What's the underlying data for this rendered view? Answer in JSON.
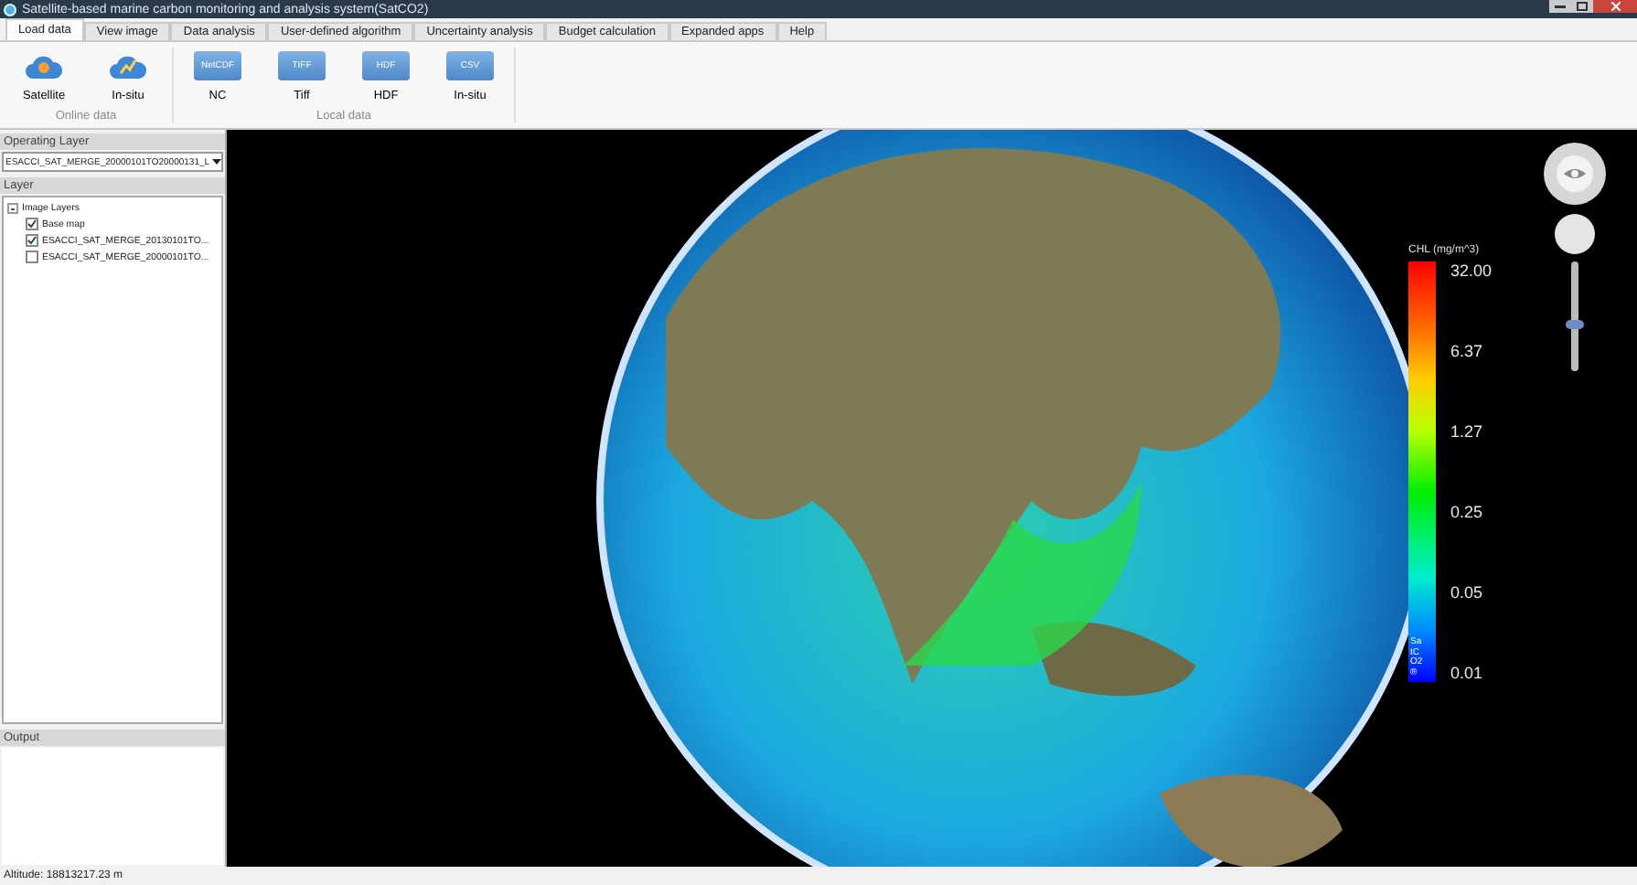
{
  "window": {
    "title": "Satellite-based marine carbon monitoring and analysis system(SatCO2)"
  },
  "tabs": [
    {
      "label": "Load data",
      "selected": true
    },
    {
      "label": "View image",
      "selected": false
    },
    {
      "label": "Data analysis",
      "selected": false
    },
    {
      "label": "User-defined algorithm",
      "selected": false
    },
    {
      "label": "Uncertainty analysis",
      "selected": false
    },
    {
      "label": "Budget calculation",
      "selected": false
    },
    {
      "label": "Expanded apps",
      "selected": false
    },
    {
      "label": "Help",
      "selected": false
    }
  ],
  "ribbon": {
    "groups": [
      {
        "label": "Online data",
        "buttons": [
          {
            "label": "Satellite",
            "kind": "cloud"
          },
          {
            "label": "In-situ",
            "kind": "cloud"
          }
        ]
      },
      {
        "label": "Local data",
        "buttons": [
          {
            "label": "NC",
            "kind": "folder",
            "badge": "NetCDF"
          },
          {
            "label": "Tiff",
            "kind": "folder",
            "badge": "TIFF"
          },
          {
            "label": "HDF",
            "kind": "folder",
            "badge": "HDF"
          },
          {
            "label": "In-situ",
            "kind": "folder",
            "badge": "CSV"
          }
        ]
      }
    ]
  },
  "operating_layer": {
    "title": "Operating Layer",
    "value": "ESACCI_SAT_MERGE_20000101TO20000131_L"
  },
  "layer_panel": {
    "title": "Layer",
    "tree": [
      {
        "label": "Image Layers",
        "expanded": true,
        "children": [
          {
            "label": "Base map",
            "checked": true
          },
          {
            "label": "ESACCI_SAT_MERGE_20130101TO...",
            "checked": true
          },
          {
            "label": "ESACCI_SAT_MERGE_20000101TO...",
            "checked": false
          }
        ]
      }
    ]
  },
  "output_panel": {
    "title": "Output"
  },
  "legend": {
    "title": "CHL (mg/m^3)",
    "labels": [
      "32.00",
      "6.37",
      "1.27",
      "0.25",
      "0.05",
      "0.01"
    ],
    "brand": "SatCO2®"
  },
  "zoom_slider": {
    "level": 0.42
  },
  "status_bar": {
    "altitude": "Altitude: 18813217.23 m"
  }
}
